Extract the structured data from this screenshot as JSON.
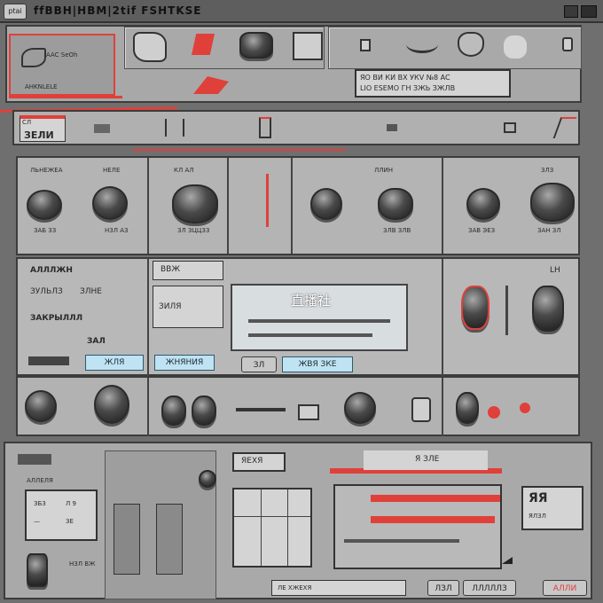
{
  "titlebar": {
    "menu_box": "ptai",
    "title": "ffBBH|HBM|2tif FSHTKSE",
    "window_buttons": [
      "minimize-button",
      "close-button"
    ]
  },
  "header": {
    "logo_text": "AAC SeOh",
    "logo_sub": "AHKNLELE",
    "readout": "ЯO ВИ КИ ВХ УКV №8 AC\nLIO ESEMO ГН ЗЖЬ ЗЖЛВ",
    "toolbar_icons": [
      "clip-icon",
      "stamp-icon",
      "cup-icon",
      "square-icon",
      "small-square-icon",
      "wave-icon",
      "shield-icon",
      "blob-icon",
      "cylinder-icon"
    ]
  },
  "tabbar": {
    "tab_label": "ЗЕЛИ",
    "tab_badge": "CЛ",
    "icons": [
      "bar-icon",
      "bracket-icon",
      "pitch-icon",
      "dash-icon",
      "plus-icon",
      "flame-icon"
    ]
  },
  "knob_bank": {
    "labels": [
      "ЗАБ ЗЗ",
      "НЗЛ АЗ",
      "ЗЛ ЗЦЦЗЗ",
      "",
      "ЗЛВ ЗЛВ",
      "ЗАВ ЭЕЗ",
      "ЗАН ЗЛ"
    ],
    "top_labels": [
      "ЛЬНЕЖЕА",
      "НЕЛЕ",
      "КЛ АЛ",
      "",
      "ЛЛИН",
      "",
      "ЗЛЗ"
    ]
  },
  "mixer": {
    "left_labels": [
      "АЛЛЛЖН",
      "ЗУЛЬЛЗ",
      "ЗЛНЕ",
      "ЗАКРЫЛЛЛ",
      "ЗАЛ"
    ],
    "left_button": "ЖЛЯ",
    "mid_top": "ВВЖ",
    "mid_label": "ЗИЛЯ",
    "mid_button": "ЖНЯНИЯ",
    "center_title": "直播社",
    "center_button_small": "ЗЛ",
    "center_button_blue": "ЖВЯ ЗКЕ",
    "right_indicator": "LH"
  },
  "lower_knobs": {
    "labels": [
      "",
      "",
      "",
      "",
      "",
      "",
      "",
      ""
    ]
  },
  "bottom": {
    "display_label": "АЛЛЕЛЯ",
    "display_values": [
      "ЗБЗ",
      "Л 9",
      "—",
      "ЗЕ"
    ],
    "side_label": "НЗЛ ВЖ",
    "mid_readout": "ЯЕХЯ",
    "right_readout": "Я ЗЛЕ",
    "right_small": "ЯЛЗЛ",
    "right_big": "ЯЯ",
    "footer_left": "ЛЕ ХЖЕХЯ",
    "footer_tabs": [
      "ЛЗЛ",
      "ЛЛЛЛЛЗ",
      "АЛЛИ"
    ]
  },
  "colors": {
    "accent_red": "#e0403a",
    "panel_gray": "#b9b9b9",
    "frame_dark": "#3c3c3c",
    "highlight_blue": "#bfe3f2"
  }
}
